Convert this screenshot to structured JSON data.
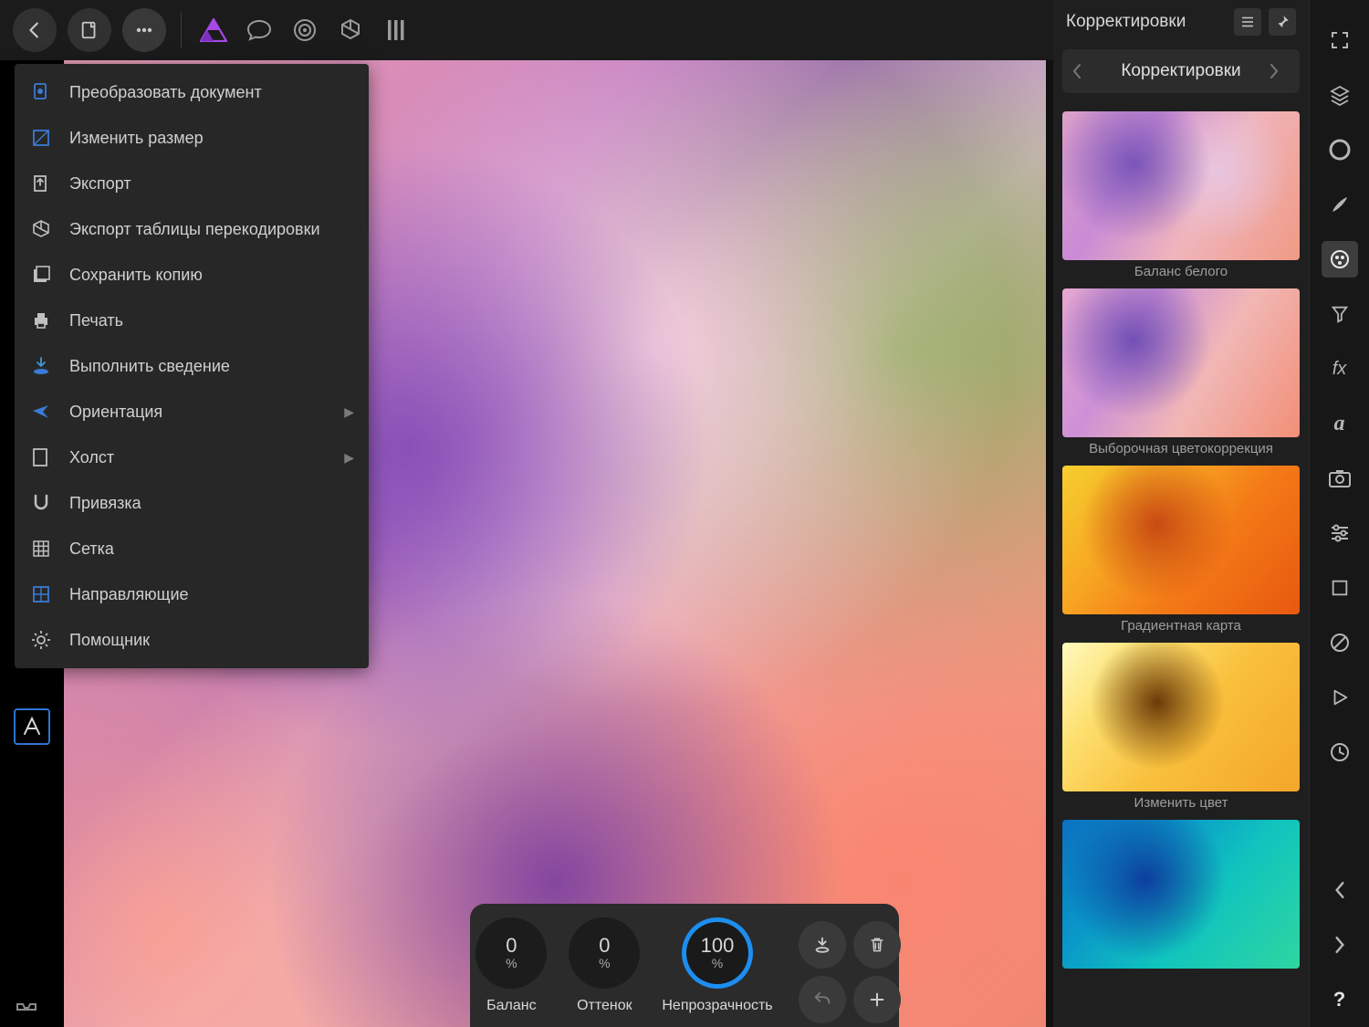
{
  "panel": {
    "header_title": "Корректировки",
    "nav_title": "Корректировки"
  },
  "menu": {
    "items": [
      {
        "label": "Преобразовать документ",
        "submenu": false
      },
      {
        "label": "Изменить размер",
        "submenu": false
      },
      {
        "label": "Экспорт",
        "submenu": false
      },
      {
        "label": "Экспорт таблицы перекодировки",
        "submenu": false
      },
      {
        "label": "Сохранить копию",
        "submenu": false
      },
      {
        "label": "Печать",
        "submenu": false
      },
      {
        "label": "Выполнить сведение",
        "submenu": false
      },
      {
        "label": "Ориентация",
        "submenu": true
      },
      {
        "label": "Холст",
        "submenu": true
      },
      {
        "label": "Привязка",
        "submenu": false
      },
      {
        "label": "Сетка",
        "submenu": false
      },
      {
        "label": "Направляющие",
        "submenu": false
      },
      {
        "label": "Помощник",
        "submenu": false
      }
    ]
  },
  "dock": {
    "dials": [
      {
        "value": "0",
        "unit": "%",
        "label": "Баланс",
        "active": false
      },
      {
        "value": "0",
        "unit": "%",
        "label": "Оттенок",
        "active": false
      },
      {
        "value": "100",
        "unit": "%",
        "label": "Непрозрачность",
        "active": true
      }
    ]
  },
  "presets": [
    {
      "label": "Баланс белого"
    },
    {
      "label": "Выборочная цветокоррекция"
    },
    {
      "label": "Градиентная карта"
    },
    {
      "label": "Изменить цвет"
    },
    {
      "label": ""
    }
  ],
  "help_glyph": "?"
}
